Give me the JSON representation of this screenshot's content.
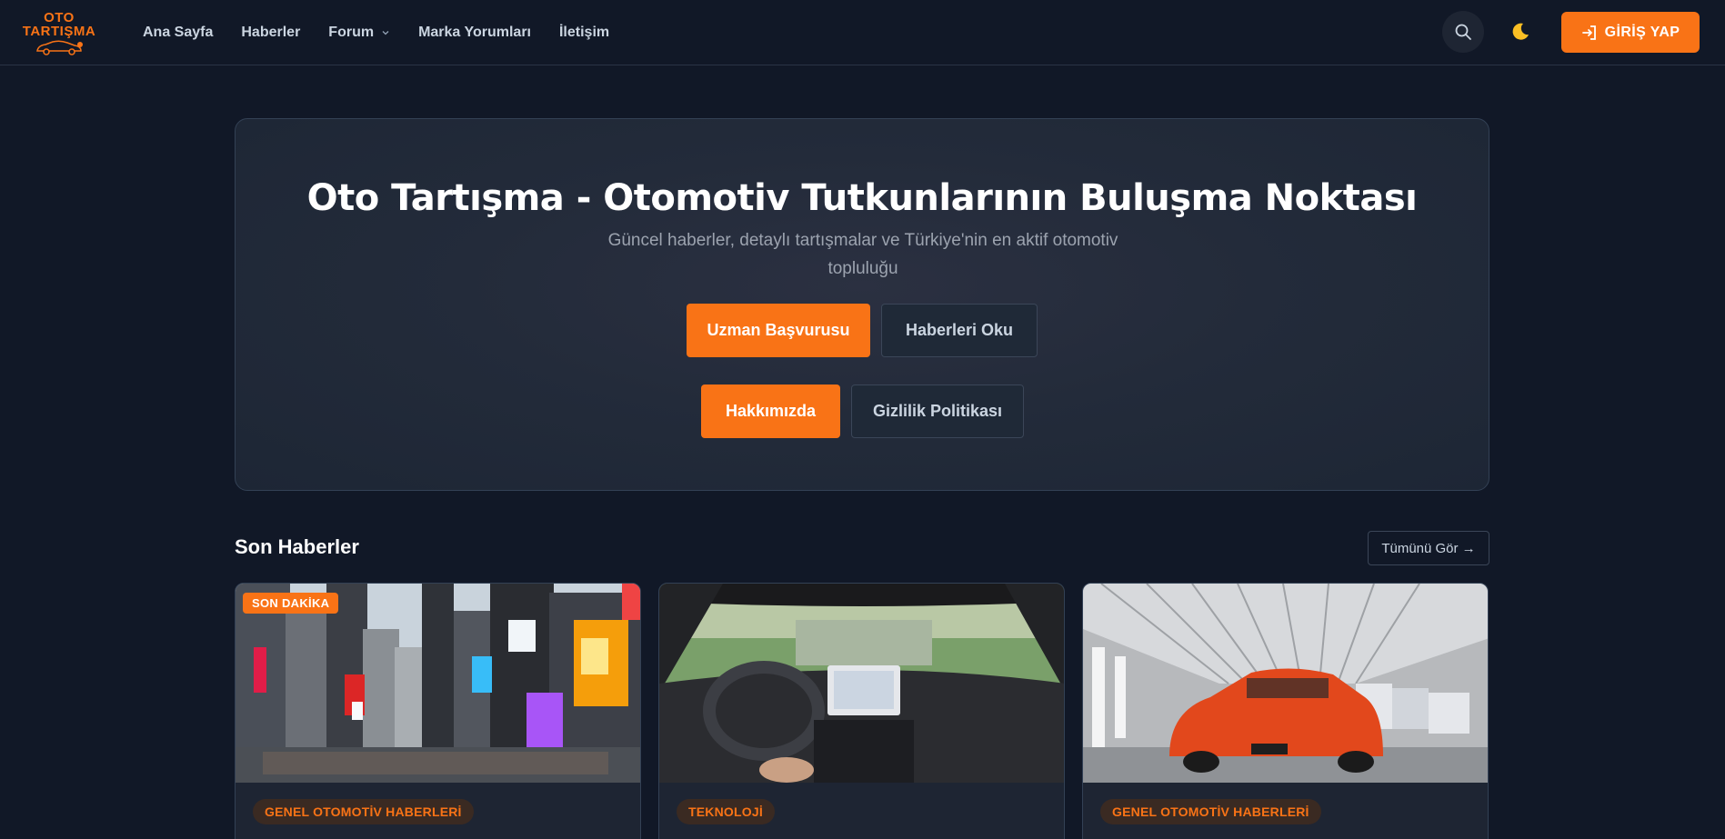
{
  "brand": {
    "line1": "OTO",
    "line2": "TARTIŞMA"
  },
  "nav": [
    {
      "label": "Ana Sayfa"
    },
    {
      "label": "Haberler"
    },
    {
      "label": "Forum"
    },
    {
      "label": "Marka Yorumları"
    },
    {
      "label": "İletişim"
    }
  ],
  "header": {
    "login_label": "GİRİŞ YAP"
  },
  "hero": {
    "title": "Oto Tartışma - Otomotiv Tutkunlarının Buluşma Noktası",
    "subtitle": "Güncel haberler, detaylı tartışmalar ve Türkiye'nin en aktif otomotiv topluluğu",
    "btn_expert": "Uzman Başvurusu",
    "btn_news": "Haberleri Oku",
    "btn_about": "Hakkımızda",
    "btn_privacy": "Gizlilik Politikası"
  },
  "news": {
    "title": "Son Haberler",
    "see_all": "Tümünü Gör →",
    "cards": [
      {
        "badge": "SON DAKİKA",
        "category": "GENEL OTOMOTİV HABERLERİ"
      },
      {
        "category": "TEKNOLOJİ"
      },
      {
        "category": "GENEL OTOMOTİV HABERLERİ"
      }
    ]
  },
  "colors": {
    "accent": "#f97316",
    "background": "#111827",
    "card": "#1e2533"
  }
}
